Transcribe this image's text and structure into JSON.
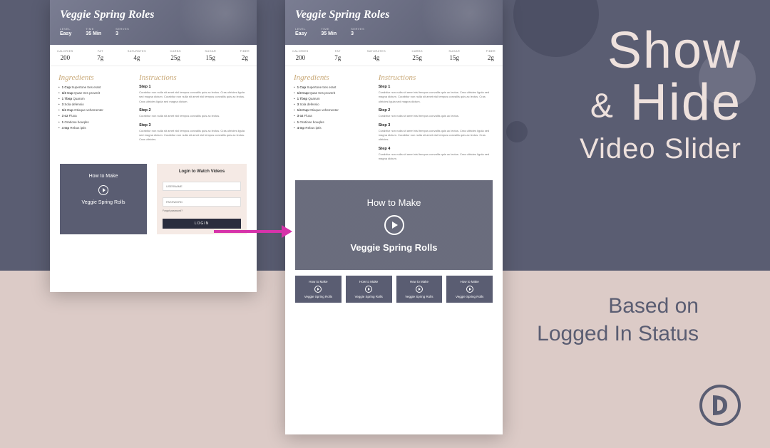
{
  "hero": {
    "line1": "Show",
    "amp": "&",
    "line2": "Hide",
    "line3": "Video Slider"
  },
  "sub": {
    "line1": "Based on",
    "line2": "Logged In Status"
  },
  "recipe": {
    "title": "Veggie Spring Roles",
    "meta": [
      {
        "label": "LEVEL",
        "value": "Easy"
      },
      {
        "label": "TIME",
        "value": "35 Min"
      },
      {
        "label": "SERVES",
        "value": "3"
      }
    ],
    "stats": [
      {
        "label": "CALORIES",
        "value": "200"
      },
      {
        "label": "FAT",
        "value": "7g"
      },
      {
        "label": "SATURATES",
        "value": "4g"
      },
      {
        "label": "CARBS",
        "value": "25g"
      },
      {
        "label": "SUGAR",
        "value": "15g"
      },
      {
        "label": "FIBER",
        "value": "2g"
      }
    ],
    "ingredients_title": "Ingredients",
    "ingredients": [
      {
        "amt": "1 Cup",
        "item": "Supertone tres erant"
      },
      {
        "amt": "1/3 Cup",
        "item": "Quae tres proverit"
      },
      {
        "amt": "1 Tbsp",
        "item": "Quarum"
      },
      {
        "amt": "3",
        "item": "Sola defensio"
      },
      {
        "amt": "1/4 Cup",
        "item": "Otioque vehementer"
      },
      {
        "amt": "3 oz",
        "item": "Fluxa"
      },
      {
        "amt": "1",
        "item": "Oratione bouqles"
      },
      {
        "amt": "4 tsp",
        "item": "Rebus iptis"
      }
    ],
    "instructions_title": "Instructions",
    "steps": [
      {
        "title": "Step 1",
        "body": "Curabitur non nulla sit amet nisl tempus convallis quis ac lectus. Cras ultricies ligula sed magna dictum. Curabitur non nulla sit amet nisl tempus convallis quis ac lectus. Cras ultricies ligula sed magna dictum."
      },
      {
        "title": "Step 2",
        "body": "Curabitur non nulla sit amet nisl tempus convallis quis ac lectus."
      },
      {
        "title": "Step 3",
        "body": "Curabitur non nulla sit amet nisl tempus convallis quis ac lectus. Cras ultricies ligula sed magna dictum. Curabitur non nulla sit amet nisl tempus convallis quis ac lectus. Cras ultricies."
      },
      {
        "title": "Step 4",
        "body": "Curabitur non nulla sit amet nisl tempus convallis quis ac lectus. Cras ultricies ligula sed magna dictum."
      }
    ]
  },
  "video_tease": {
    "top": "How to Make",
    "bottom": "Veggie Spring Rolls"
  },
  "login": {
    "title": "Login to Watch Videos",
    "username_ph": "USERNAME",
    "password_ph": "PASSWORD",
    "forgot": "Forgot password?",
    "button": "LOGIN"
  },
  "video_full": {
    "top": "How to Make",
    "bottom": "Veggie Spring Rolls"
  },
  "thumbs": [
    {
      "top": "How to Make",
      "bottom": "Veggie Spring Rolls"
    },
    {
      "top": "How to Make",
      "bottom": "Veggie Spring Rolls"
    },
    {
      "top": "How to Make",
      "bottom": "Veggie Spring Rolls"
    },
    {
      "top": "How to Make",
      "bottom": "Veggie Spring Rolls"
    }
  ]
}
